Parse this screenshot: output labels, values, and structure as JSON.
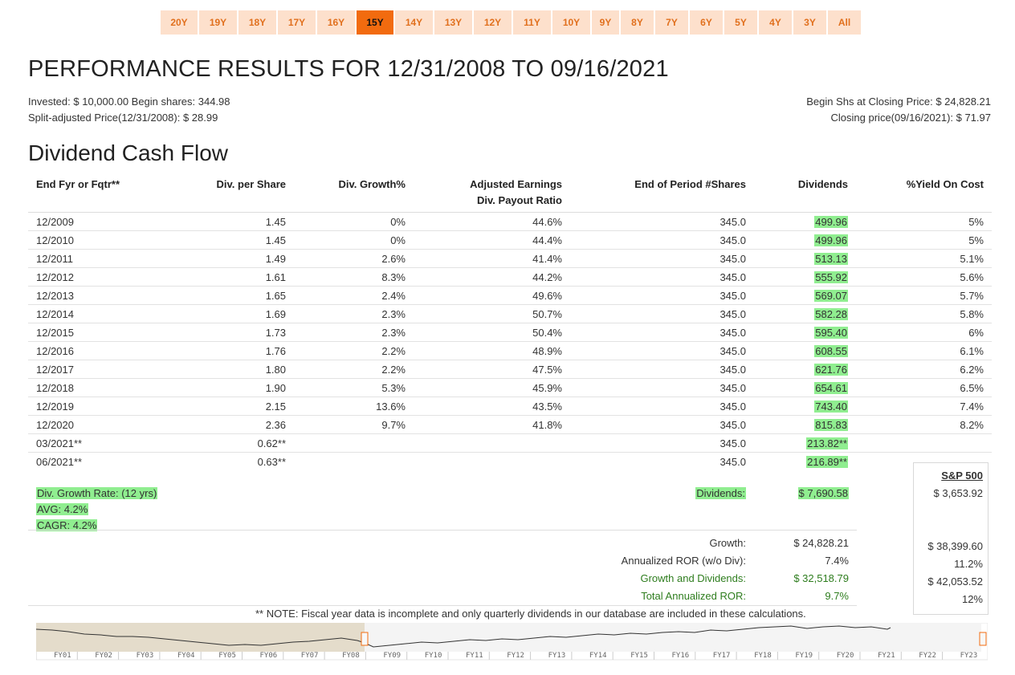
{
  "periods": [
    "20Y",
    "19Y",
    "18Y",
    "17Y",
    "16Y",
    "15Y",
    "14Y",
    "13Y",
    "12Y",
    "11Y",
    "10Y",
    "9Y",
    "8Y",
    "7Y",
    "6Y",
    "5Y",
    "4Y",
    "3Y",
    "All"
  ],
  "active_period": "15Y",
  "title": "PERFORMANCE RESULTS FOR 12/31/2008 TO 09/16/2021",
  "info": {
    "invested": "Invested: $ 10,000.00 Begin shares: 344.98",
    "split_price": "Split-adjusted Price(12/31/2008): $ 28.99",
    "begin_shs": "Begin Shs at Closing Price: $ 24,828.21",
    "closing_price": "Closing price(09/16/2021): $ 71.97"
  },
  "section_title": "Dividend Cash Flow",
  "columns": {
    "c1": "End Fyr or Fqtr**",
    "c2": "Div. per Share",
    "c3": "Div. Growth%",
    "c4a": "Adjusted Earnings",
    "c4b": "Div. Payout Ratio",
    "c5": "End of Period #Shares",
    "c6": "Dividends",
    "c7": "%Yield On Cost"
  },
  "rows": [
    {
      "period": "12/2009",
      "dps": "1.45",
      "growth": "0%",
      "payout": "44.6%",
      "shares": "345.0",
      "div": "499.96",
      "yoc": "5%"
    },
    {
      "period": "12/2010",
      "dps": "1.45",
      "growth": "0%",
      "payout": "44.4%",
      "shares": "345.0",
      "div": "499.96",
      "yoc": "5%"
    },
    {
      "period": "12/2011",
      "dps": "1.49",
      "growth": "2.6%",
      "payout": "41.4%",
      "shares": "345.0",
      "div": "513.13",
      "yoc": "5.1%"
    },
    {
      "period": "12/2012",
      "dps": "1.61",
      "growth": "8.3%",
      "payout": "44.2%",
      "shares": "345.0",
      "div": "555.92",
      "yoc": "5.6%"
    },
    {
      "period": "12/2013",
      "dps": "1.65",
      "growth": "2.4%",
      "payout": "49.6%",
      "shares": "345.0",
      "div": "569.07",
      "yoc": "5.7%"
    },
    {
      "period": "12/2014",
      "dps": "1.69",
      "growth": "2.3%",
      "payout": "50.7%",
      "shares": "345.0",
      "div": "582.28",
      "yoc": "5.8%"
    },
    {
      "period": "12/2015",
      "dps": "1.73",
      "growth": "2.3%",
      "payout": "50.4%",
      "shares": "345.0",
      "div": "595.40",
      "yoc": "6%"
    },
    {
      "period": "12/2016",
      "dps": "1.76",
      "growth": "2.2%",
      "payout": "48.9%",
      "shares": "345.0",
      "div": "608.55",
      "yoc": "6.1%"
    },
    {
      "period": "12/2017",
      "dps": "1.80",
      "growth": "2.2%",
      "payout": "47.5%",
      "shares": "345.0",
      "div": "621.76",
      "yoc": "6.2%"
    },
    {
      "period": "12/2018",
      "dps": "1.90",
      "growth": "5.3%",
      "payout": "45.9%",
      "shares": "345.0",
      "div": "654.61",
      "yoc": "6.5%"
    },
    {
      "period": "12/2019",
      "dps": "2.15",
      "growth": "13.6%",
      "payout": "43.5%",
      "shares": "345.0",
      "div": "743.40",
      "yoc": "7.4%"
    },
    {
      "period": "12/2020",
      "dps": "2.36",
      "growth": "9.7%",
      "payout": "41.8%",
      "shares": "345.0",
      "div": "815.83",
      "yoc": "8.2%"
    },
    {
      "period": "03/2021**",
      "dps": "0.62**",
      "growth": "",
      "payout": "",
      "shares": "345.0",
      "div": "213.82**",
      "yoc": ""
    },
    {
      "period": "06/2021**",
      "dps": "0.63**",
      "growth": "",
      "payout": "",
      "shares": "345.0",
      "div": "216.89**",
      "yoc": ""
    }
  ],
  "summary": {
    "growth_rate": "Div. Growth Rate: (12 yrs)",
    "avg": "AVG: 4.2%",
    "cagr": "CAGR: 4.2%",
    "dividends_label": "Dividends:",
    "dividends_value": "$ 7,690.58",
    "growth_label": "Growth:",
    "growth_value": "$ 24,828.21",
    "ann_ror_label": "Annualized ROR (w/o Div):",
    "ann_ror_value": "7.4%",
    "gd_label": "Growth and Dividends:",
    "gd_value": "$ 32,518.79",
    "total_ror_label": "Total Annualized ROR:",
    "total_ror_value": "9.7%"
  },
  "sp500": {
    "title": "S&P 500",
    "dividends": "$ 3,653.92",
    "growth": "$ 38,399.60",
    "ann_ror": "11.2%",
    "gd": "$ 42,053.52",
    "total_ror": "12%"
  },
  "note": "** NOTE: Fiscal year data is incomplete and only quarterly dividends in our database are included in these calculations.",
  "navigator": {
    "labels": [
      "FY01",
      "FY02",
      "FY03",
      "FY04",
      "FY05",
      "FY06",
      "FY07",
      "FY08",
      "FY09",
      "FY10",
      "FY11",
      "FY12",
      "FY13",
      "FY14",
      "FY15",
      "FY16",
      "FY17",
      "FY18",
      "FY19",
      "FY20",
      "FY21",
      "FY22",
      "FY23"
    ],
    "selected_from": "FY09",
    "selected_to": "FY23"
  },
  "colors": {
    "period_bg": "#fde0cc",
    "period_text": "#e1701e",
    "period_active": "#f26b0f",
    "highlight": "#90ee90",
    "green_text": "#2e7d1e"
  }
}
